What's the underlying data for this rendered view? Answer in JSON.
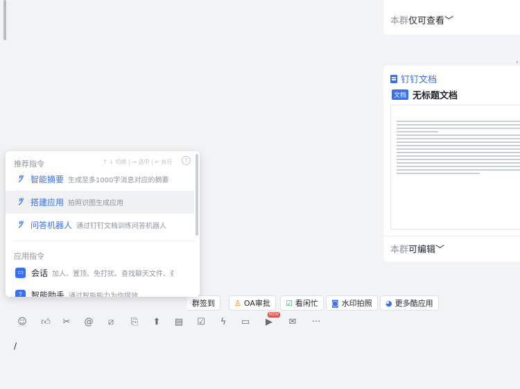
{
  "chat": {
    "card_top": {
      "permission_prefix": "本群",
      "permission_text": "仅可查看",
      "chevron": "chevron-down-icon"
    },
    "doc_card": {
      "brand": "钉钉文档",
      "tag": "文档",
      "title": "无标题文档",
      "permission_prefix": "本群",
      "permission_text": "可编辑",
      "chevron": "chevron-down-icon"
    }
  },
  "command_popup": {
    "header": "推荐指令",
    "hint": "↑ ↓ 切换 | → 选中 | ↵ 执行",
    "help": "?",
    "recommended": [
      {
        "label": "智能摘要",
        "desc": "生成至多1000字消息对应的摘要",
        "icon": "ai-magic-icon"
      },
      {
        "label": "搭建应用",
        "desc": "拍照识图生成应用",
        "icon": "ai-magic-icon"
      },
      {
        "label": "问答机器人",
        "desc": "通过钉钉文档训练问答机器人",
        "icon": "ai-magic-icon"
      }
    ],
    "app_header": "应用指令",
    "apps": [
      {
        "label": "会话",
        "desc": "加人、置顶、免打扰、查找聊天文件、查找聊天记",
        "icon": "chat-app-icon"
      },
      {
        "label": "智能助手",
        "desc": "通过智能能力为你提效",
        "icon": "ai-assistant-icon"
      }
    ]
  },
  "toolbar": {
    "buttons": [
      {
        "label": "群签到",
        "icon": "checkin-icon"
      },
      {
        "label": "OA审批",
        "icon": "approval-icon",
        "color": "#ff8800"
      },
      {
        "label": "看闲忙",
        "icon": "calendar-check-icon",
        "color": "#2db45f"
      },
      {
        "label": "水印拍照",
        "icon": "camera-icon",
        "color": "#3370ff"
      },
      {
        "label": "更多酷应用",
        "icon": "more-apps-icon",
        "color": "#3370ff"
      }
    ]
  },
  "composer": {
    "new_badge": "NEW",
    "input_value": "/",
    "icons": [
      "emoji-icon",
      "thumbs-up-icon",
      "scissors-icon",
      "mention-icon",
      "slash-command-icon",
      "file-add-icon",
      "upload-icon",
      "schedule-icon",
      "task-check-icon",
      "flash-icon",
      "video-icon",
      "play-icon",
      "mail-icon",
      "more-icon"
    ]
  }
}
